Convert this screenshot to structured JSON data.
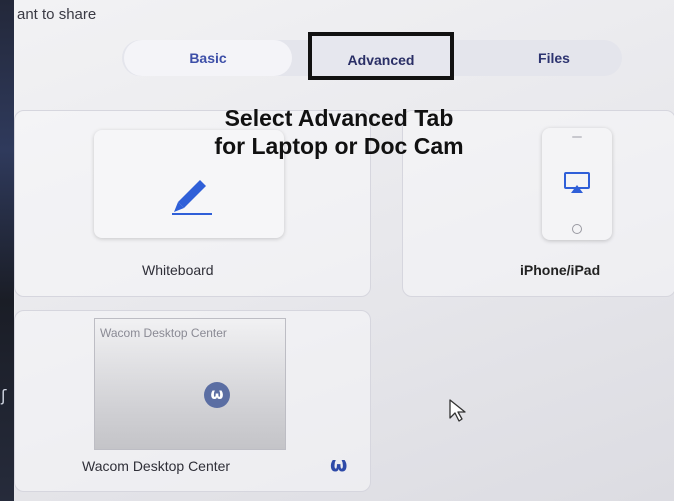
{
  "header": {
    "title": "ant to share"
  },
  "tabs": [
    {
      "label": "Basic",
      "selected": false
    },
    {
      "label": "Advanced",
      "selected": true
    },
    {
      "label": "Files",
      "selected": false
    }
  ],
  "annotation": {
    "line1": "Select Advanced Tab",
    "line2": "for Laptop or Doc Cam",
    "highlight_color": "#111111"
  },
  "tiles": {
    "whiteboard": {
      "label": "Whiteboard",
      "icon": "pen-icon"
    },
    "iphone": {
      "label": "iPhone/iPad",
      "icon": "airplay-icon"
    },
    "wacom": {
      "label": "Wacom Desktop Center",
      "window_title": "Wacom Desktop Center",
      "logo_glyph": "ω",
      "mark_glyph": "ω",
      "icon": "wacom-logo-icon"
    }
  },
  "colors": {
    "accent": "#2f5fd8",
    "tab_text": "#2d3a8c"
  },
  "left_strip_glyph": "ʃ"
}
